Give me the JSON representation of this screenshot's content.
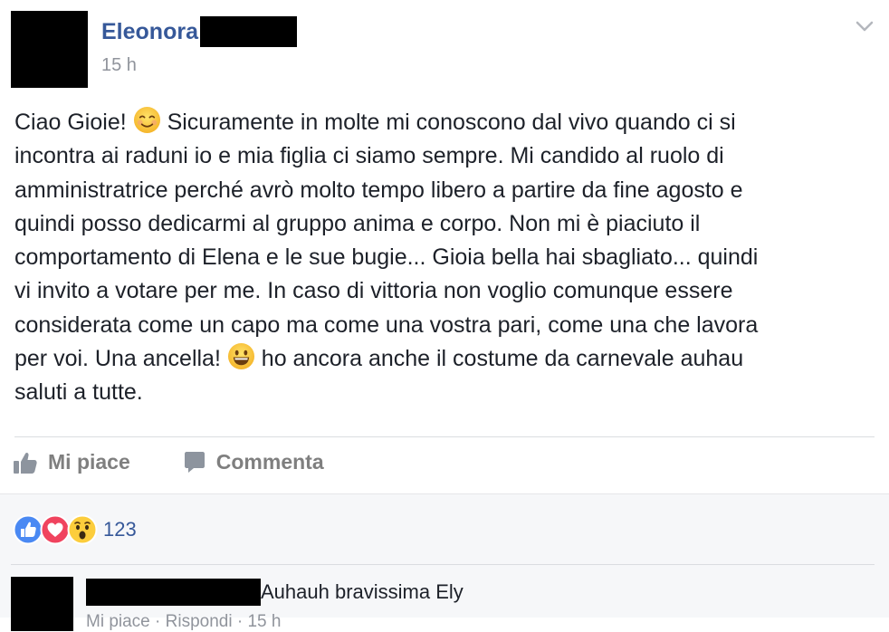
{
  "post": {
    "author_name": "Eleonora",
    "timestamp": "15 h",
    "text_lines": [
      [
        "Ciao Gioie! ",
        "smiling-face-emoji",
        " Sicuramente in molte mi conoscono dal vivo quando ci si"
      ],
      [
        "incontra ai raduni io e mia figlia ci siamo sempre. Mi candido al ruolo di"
      ],
      [
        "amministratrice perché avrò molto tempo libero a partire da fine agosto e"
      ],
      [
        "quindi posso dedicarmi al gruppo anima e corpo. Non mi è piaciuto il"
      ],
      [
        "comportamento di Elena e le sue bugie... Gioia bella hai sbagliato... quindi"
      ],
      [
        "vi invito a votare per me. In caso di vittoria non voglio comunque essere"
      ],
      [
        "considerata come un capo ma come una vostra pari, come una che lavora"
      ],
      [
        "per voi. Una ancella! ",
        "grinning-face-emoji",
        " ho ancora anche il costume da carnevale auhau"
      ],
      [
        "saluti a tutte."
      ]
    ]
  },
  "actions": {
    "like_label": "Mi piace",
    "comment_label": "Comment­a"
  },
  "reactions": {
    "icons": [
      "like-reaction-icon",
      "love-reaction-icon",
      "wow-reaction-icon"
    ],
    "count": "123"
  },
  "comment": {
    "text": "Auhauh bravissima Ely",
    "partial_links": "Mi piace · Rispondi · 15 h"
  },
  "colors": {
    "link_blue": "#365899",
    "meta_gray": "#90949c",
    "action_gray": "#7f7f7f",
    "feedback_bg": "#f6f7f9",
    "like_blue": "#4a89f3",
    "love_red": "#f0435e",
    "wow_yellow": "#fccd3c"
  }
}
